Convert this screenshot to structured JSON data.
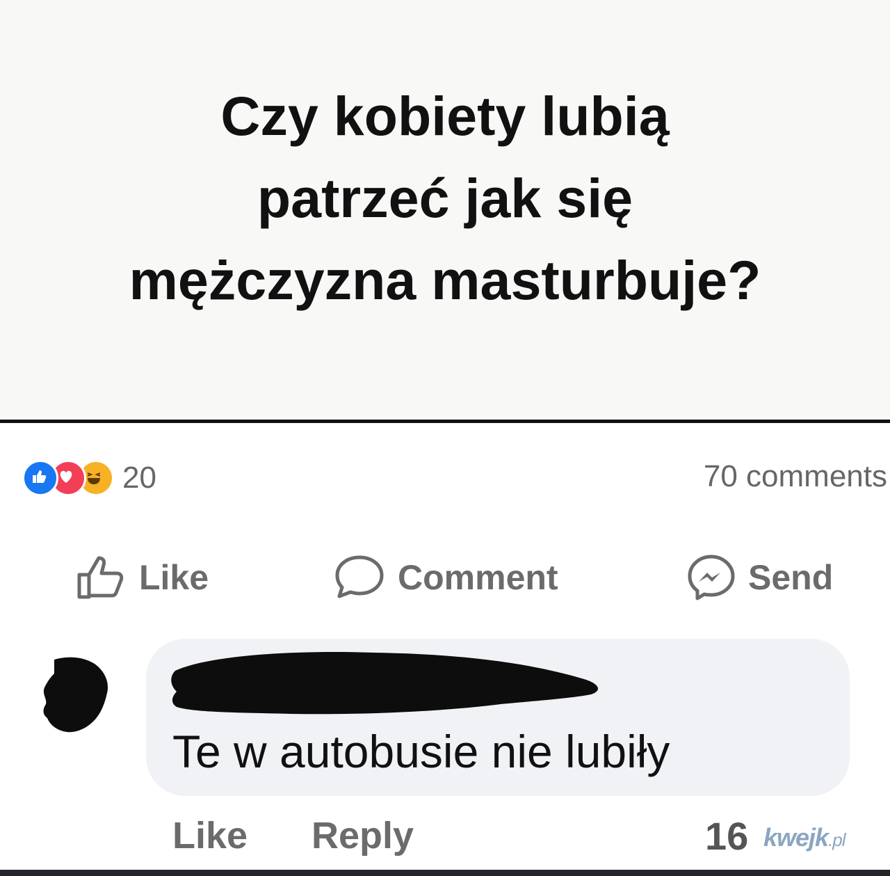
{
  "post": {
    "title": "Czy kobiety lubią\npatrzeć jak się\nmężczyzna masturbuje?"
  },
  "stats": {
    "reactions_count": "20",
    "comments_count": "70 comments",
    "reaction_icons": [
      "like-icon",
      "love-icon",
      "haha-icon"
    ]
  },
  "actions": {
    "like_label": "Like",
    "comment_label": "Comment",
    "send_label": "Send"
  },
  "comment": {
    "text": "Te w autobusie nie lubiły",
    "like_label": "Like",
    "reply_label": "Reply",
    "reactions_count": "16"
  },
  "colors": {
    "like_blue": "#1877f2",
    "love_red": "#f33e58",
    "haha_yellow": "#f7b125",
    "muted_text": "#6b6b6b"
  }
}
